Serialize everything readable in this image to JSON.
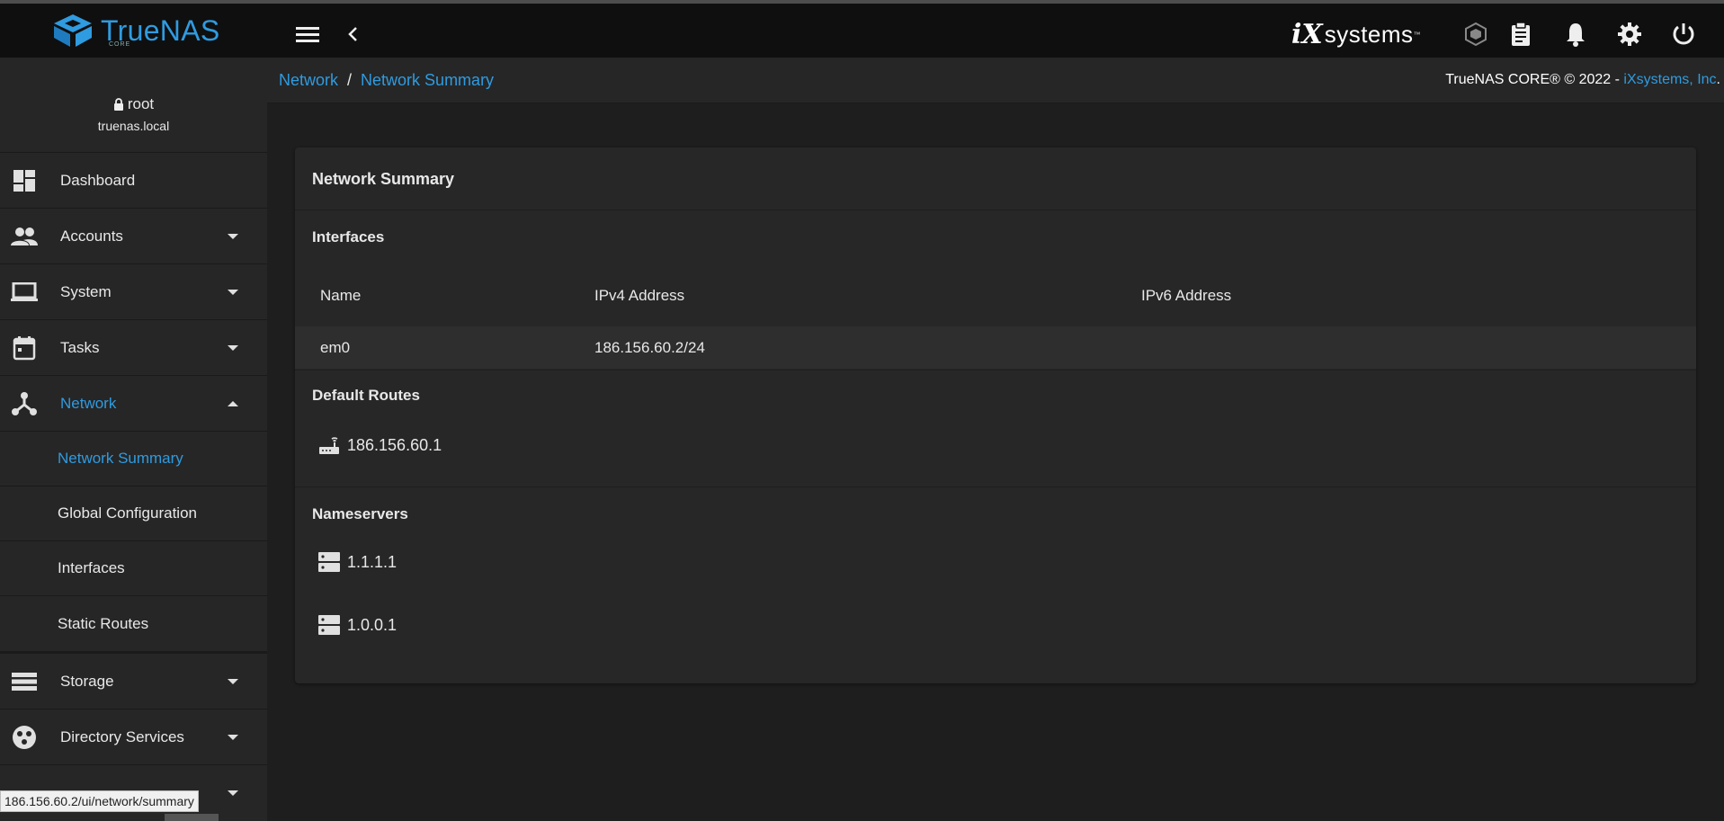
{
  "topbar": {
    "logo_text": "TrueNAS",
    "logo_sub": "CORE",
    "vendor_mark": "iX",
    "vendor_name": "systems",
    "vendor_tm": "™"
  },
  "user": {
    "name": "root",
    "host": "truenas.local"
  },
  "sidebar": {
    "items": [
      {
        "label": "Dashboard"
      },
      {
        "label": "Accounts"
      },
      {
        "label": "System"
      },
      {
        "label": "Tasks"
      },
      {
        "label": "Network"
      },
      {
        "label": "Storage"
      },
      {
        "label": "Directory Services"
      }
    ],
    "network_sub": [
      {
        "label": "Network Summary"
      },
      {
        "label": "Global Configuration"
      },
      {
        "label": "Interfaces"
      },
      {
        "label": "Static Routes"
      }
    ]
  },
  "header": {
    "breadcrumb": [
      "Network",
      "Network Summary"
    ],
    "copyright_prefix": "TrueNAS CORE® © 2022 - ",
    "copyright_link": "iXsystems, Inc",
    "copyright_suffix": "."
  },
  "card": {
    "title": "Network Summary",
    "interfaces_title": "Interfaces",
    "columns": [
      "Name",
      "IPv4 Address",
      "IPv6 Address"
    ],
    "rows": [
      {
        "name": "em0",
        "ipv4": "186.156.60.2/24",
        "ipv6": ""
      }
    ],
    "routes_title": "Default Routes",
    "routes": [
      "186.156.60.1"
    ],
    "nameservers_title": "Nameservers",
    "nameservers": [
      "1.1.1.1",
      "1.0.0.1"
    ]
  },
  "statusbar": {
    "url": "186.156.60.2/ui/network/summary"
  },
  "colors": {
    "accent": "#2f9be0",
    "background": "#1e1e1e",
    "panel": "#262626"
  }
}
